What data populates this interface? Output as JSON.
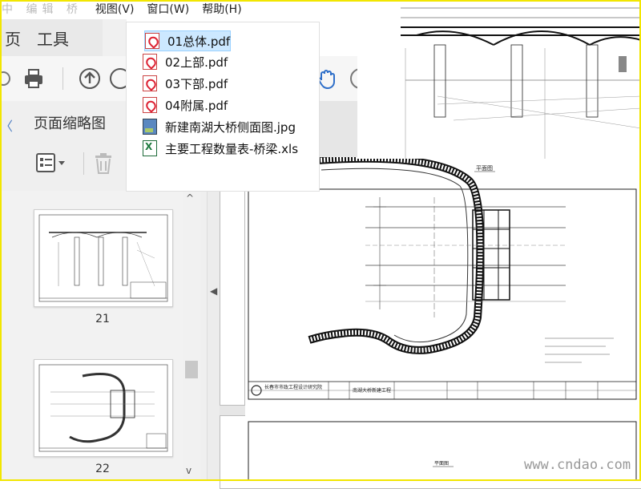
{
  "menubar": {
    "faded_text": "中 编辑 桥",
    "items": [
      "编辑",
      "视图(V)",
      "窗口(W)",
      "帮助(H)"
    ]
  },
  "tabs": [
    {
      "label": "页"
    },
    {
      "label": "工具"
    }
  ],
  "sidebar": {
    "panel_title": "页面缩略图",
    "thumbnails": [
      {
        "page": "21"
      },
      {
        "page": "22"
      }
    ]
  },
  "file_list": [
    {
      "name": "01总体.pdf",
      "type": "pdf-icon",
      "selected": true
    },
    {
      "name": "02上部.pdf",
      "type": "pdf-icon",
      "selected": false
    },
    {
      "name": "03下部.pdf",
      "type": "pdf-icon",
      "selected": false
    },
    {
      "name": "04附属.pdf",
      "type": "pdf-icon",
      "selected": false
    },
    {
      "name": "新建南湖大桥侧面图.jpg",
      "type": "image-icon",
      "selected": false
    },
    {
      "name": "主要工程数量表-桥梁.xls",
      "type": "excel-icon",
      "selected": false
    }
  ],
  "toolbar_icons": [
    "print-icon",
    "page-up-icon",
    "page-down-icon",
    "hand-tool-icon"
  ],
  "sidebar_tools": [
    "thumbnail-options-icon",
    "delete-icon"
  ],
  "drawing": {
    "plan_label": "平面图",
    "institute": "长春市市政工程设计研究院",
    "project": "南湖大桥新建工程"
  },
  "watermark": "www.cndao.com",
  "colors": {
    "frame": "#f2e600",
    "selection": "#cce8ff",
    "accent": "#4a7cc2",
    "pdf_red": "#d22b2b"
  }
}
